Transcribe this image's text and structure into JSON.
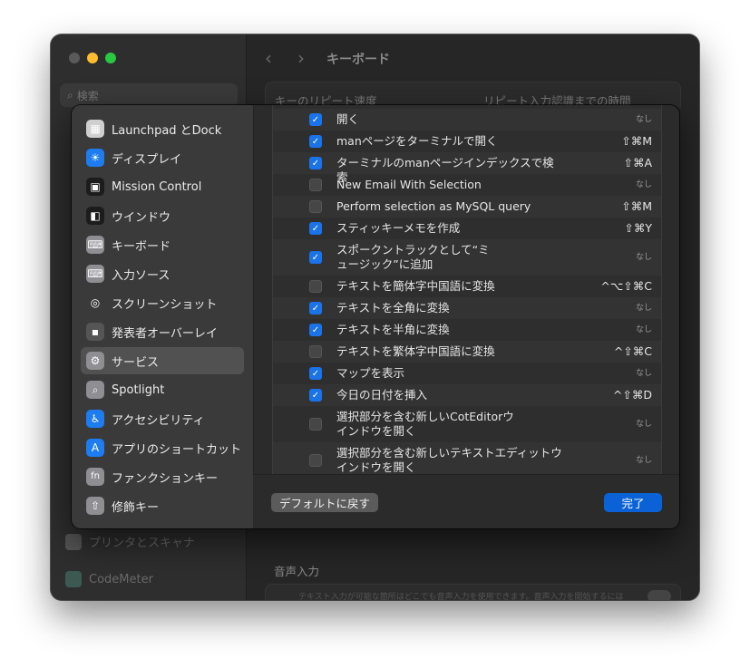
{
  "window": {
    "title": "キーボード",
    "search_placeholder": "検索",
    "bg_group_left": "キーのリピート速度",
    "bg_group_right": "リピート入力認識までの時間",
    "bg_sidebar_items": [
      "プリンタとスキャナ",
      "CodeMeter"
    ],
    "voice_section_label": "音声入力",
    "voice_description": "テキスト入力が可能な箇所はどこでも音声入力を使用できます。音声入力を開始するには"
  },
  "sheet": {
    "sidebar_items": [
      {
        "label": "Launchpad とDock",
        "icon": "launchpad-dock-icon",
        "color": "#cfcfcf"
      },
      {
        "label": "ディスプレイ",
        "icon": "display-brightness-icon",
        "color": "#1e7cf2"
      },
      {
        "label": "Mission Control",
        "icon": "mission-control-icon",
        "color": "#1c1c1c"
      },
      {
        "label": "ウインドウ",
        "icon": "window-icon",
        "color": "#1c1c1c"
      },
      {
        "label": "キーボード",
        "icon": "keyboard-icon",
        "color": "#8e8e93"
      },
      {
        "label": "入力ソース",
        "icon": "input-source-icon",
        "color": "#8e8e93"
      },
      {
        "label": "スクリーンショット",
        "icon": "screenshot-icon",
        "color": "#3a3a3a"
      },
      {
        "label": "発表者オーバーレイ",
        "icon": "presenter-overlay-icon",
        "color": "#555555"
      },
      {
        "label": "サービス",
        "icon": "services-gear-icon",
        "color": "#8e8e93",
        "selected": true
      },
      {
        "label": "Spotlight",
        "icon": "spotlight-icon",
        "color": "#8e8e93"
      },
      {
        "label": "アクセシビリティ",
        "icon": "accessibility-icon",
        "color": "#1e7cf2"
      },
      {
        "label": "アプリのショートカット",
        "icon": "app-store-icon",
        "color": "#1e7cf2"
      },
      {
        "label": "ファンクションキー",
        "icon": "fn-key-icon",
        "color": "#8e8e93"
      },
      {
        "label": "修飾キー",
        "icon": "modifier-key-icon",
        "color": "#8e8e93"
      }
    ],
    "services": [
      {
        "label": "開く",
        "checked": true,
        "shortcut": "なし"
      },
      {
        "label": "manページをターミナルで開く",
        "checked": true,
        "shortcut": "⇧⌘M"
      },
      {
        "label": "ターミナルのmanページインデックスで検索",
        "checked": true,
        "shortcut": "⇧⌘A"
      },
      {
        "label": "New Email With Selection",
        "checked": false,
        "shortcut": "なし"
      },
      {
        "label": "Perform selection as MySQL query",
        "checked": false,
        "shortcut": "⇧⌘M"
      },
      {
        "label": "スティッキーメモを作成",
        "checked": true,
        "shortcut": "⇧⌘Y"
      },
      {
        "label": "スポークントラックとして“ミュージック”に追加",
        "checked": true,
        "shortcut": "なし"
      },
      {
        "label": "テキストを簡体字中国語に変換",
        "checked": false,
        "shortcut": "^⌥⇧⌘C"
      },
      {
        "label": "テキストを全角に変換",
        "checked": true,
        "shortcut": "なし"
      },
      {
        "label": "テキストを半角に変換",
        "checked": true,
        "shortcut": "なし"
      },
      {
        "label": "テキストを繁体字中国語に変換",
        "checked": false,
        "shortcut": "^⇧⌘C"
      },
      {
        "label": "マップを表示",
        "checked": true,
        "shortcut": "なし"
      },
      {
        "label": "今日の日付を挿入",
        "checked": true,
        "shortcut": "^⇧⌘D"
      },
      {
        "label": "選択部分を含む新しいCotEditorウインドウを開く",
        "checked": false,
        "shortcut": "なし"
      },
      {
        "label": "選択部分を含む新しいテキストエディットウインドウを開く",
        "checked": false,
        "shortcut": "なし"
      }
    ],
    "restore_defaults_label": "デフォルトに戻す",
    "done_label": "完了"
  }
}
